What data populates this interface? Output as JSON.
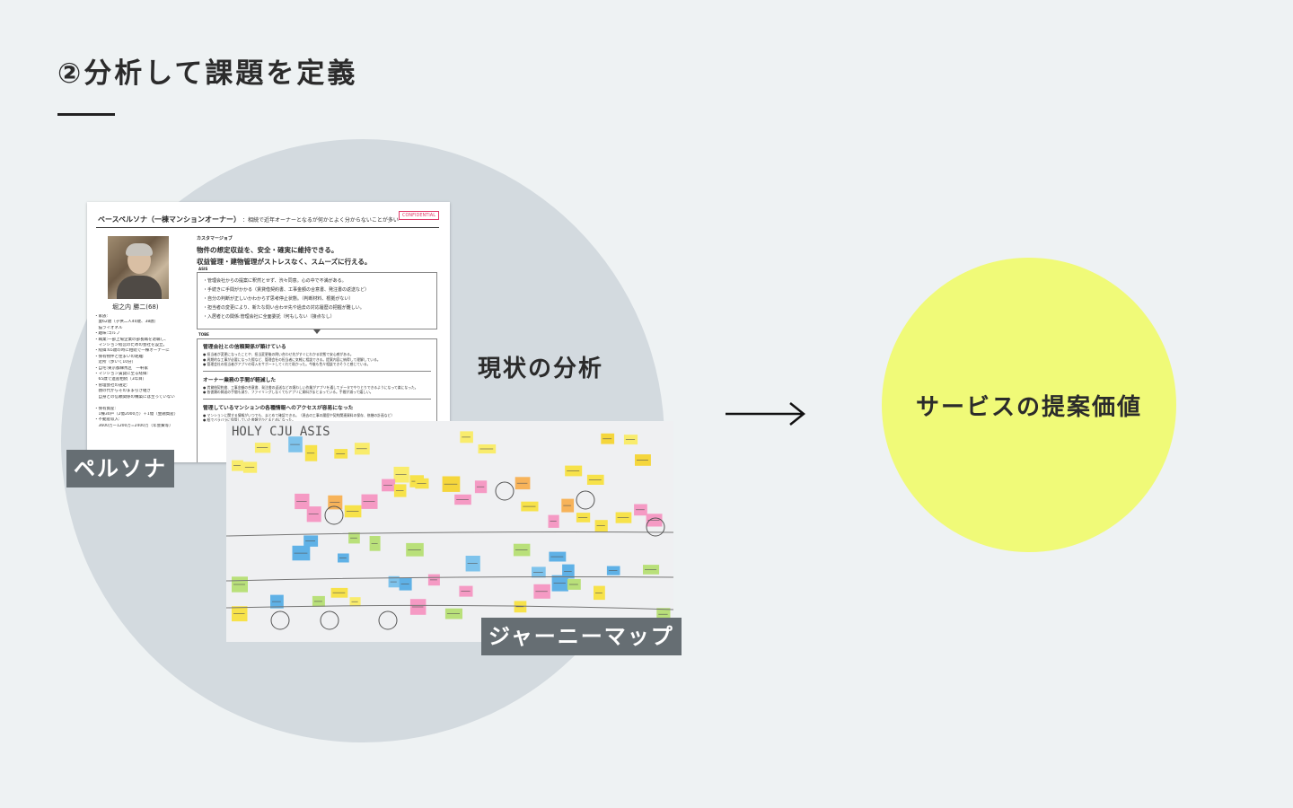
{
  "title": "②分析して課題を定義",
  "analysis_title": "現状の分析",
  "persona_label": "ペルソナ",
  "journey_label": "ジャーニーマップ",
  "value_label": "サービスの提案価値",
  "colors": {
    "background": "#eef2f3",
    "big_circle": "#d3dadf",
    "value_circle": "#f0fa78",
    "label_bg": "#666e73",
    "accent_pink": "#e03a6a"
  },
  "persona_doc": {
    "header": "ベースペルソナ（一棟マンションオーナー）",
    "header_sub": "：相続で近年オーナーとなるが何かとよく分からないことが多い",
    "confidential": "CONFIDENTIAL",
    "name": "堀之内 勝二(68)",
    "left_list": [
      "・家族:",
      "　妻62歳（子供二人40歳、38歳）",
      "　猫ライオネル",
      "・趣味:ゴルフ",
      "・職業:一部上場企業の部長職を退職し、",
      "　マンション経営のための会社を設立。",
      "・経緯:65歳の時に相続で一棟オーナーに",
      "・保有物件と住まいの距離:",
      "　近所（歩いて10分）",
      "・自宅:東京都練馬区　一軒家",
      "・マンション賃貸に至る経緯:",
      "　65歳で遺産相続（3年目）",
      "・管理会社の選定:",
      "　親の代からそのまま引き継ぎ",
      "　自身との信頼関係の構築には至っていない",
      "",
      "・保有資産:",
      "　1棟30戸（2億2000万）＋1億（金融資産）",
      "・不動産収入:",
      "　3600万ー1200万=2400万（年会費等）"
    ],
    "cj_label": "カスタマージョブ",
    "goals": [
      "物件の想定収益を、安全・確実に維持できる。",
      "収益管理・建物管理がストレスなく、スムーズに行える。"
    ],
    "asis_label": "ASIS",
    "asis_items": [
      "・管理会社からの提案に釈然とせず、渋々同意。心の中で不満がある。",
      "・手続きに手間がかかる（賃貸借契約書、工事金額の合意書、発注書の返送など）",
      "・自分の判断が正しいかわからず思考停止状態。（判断材料、根拠がない）",
      "・担当者の変更により、新たな問い合わせ先や過去の対応履歴の把握が難しい。",
      "・入居者との関係:管理会社に全面委託（何もしない（接点なし）"
    ],
    "tobe_label": "TOBE",
    "tobe_sections": [
      {
        "heading": "管理会社との信頼関係が築けている",
        "lines": [
          "● 担当者が変更になったことや、担当変更後の問い合わせ先がすぐにわかる状態で安心感がある。",
          "● 周期的な工事が必要になった際など、管理会社の担当者に気軽に相談できる。提案内容に納得して理解している。",
          "● 管理会社の担当者がアプリの導入をサポートしてくれて助かった。今後も色々相談できそうと感じている。"
        ]
      },
      {
        "heading": "オーナー業務の手間が軽減した",
        "lines": [
          "● 賃貸借契約書、工事金額の合意書、発注書の返送などの煩わしい作業がアプリを通してデータでやりとりできるようになって楽になった。",
          "● 各書類の郵送の手間も減り、ファイリングしなくてもアプリに資料がまとまっている。手間が減って嬉しい。"
        ]
      },
      {
        "heading": "管理しているマンションの各種情報へのアクセスが容易になった",
        "lines": [
          "● マンションに関する情報がいつでも、まとめて確認できる。（過去の工事の履歴や契約関連資料の保存、修繕の計画など）",
          "● 紙でバラバラに保管していた書類がひとまとめになった。"
        ]
      }
    ]
  },
  "journey_photo": {
    "handwritten_text": "HOLY CJU ASIS"
  }
}
